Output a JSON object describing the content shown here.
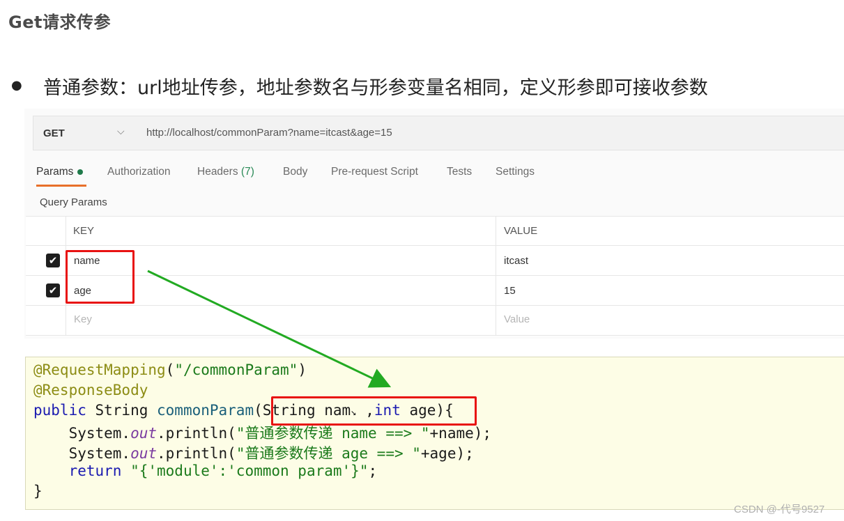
{
  "title": "Get请求传参",
  "bullet": {
    "symbol": "●",
    "text": "普通参数：url地址传参，地址参数名与形参变量名相同，定义形参即可接收参数"
  },
  "request": {
    "method": "GET",
    "url": "http://localhost/commonParam?name=itcast&age=15"
  },
  "tabs": [
    {
      "label": "Params"
    },
    {
      "label": "Authorization"
    },
    {
      "label": "Headers",
      "count": "(7)"
    },
    {
      "label": "Body"
    },
    {
      "label": "Pre-request Script"
    },
    {
      "label": "Tests"
    },
    {
      "label": "Settings"
    }
  ],
  "query_params_label": "Query Params",
  "table": {
    "headers": {
      "key": "KEY",
      "value": "VALUE"
    },
    "rows": [
      {
        "key": "name",
        "value": "itcast",
        "checked": true
      },
      {
        "key": "age",
        "value": "15",
        "checked": true
      }
    ],
    "placeholder": {
      "key": "Key",
      "value": "Value"
    }
  },
  "code": {
    "line1": {
      "ann": "@RequestMapping",
      "open": "(",
      "str": "\"/commonParam\"",
      "close": ")"
    },
    "line2": {
      "ann": "@ResponseBody"
    },
    "line3": {
      "kw": "public",
      "type": " String ",
      "fn": "commonParam",
      "params1": "(String nam",
      "cursor": "↘",
      "params2": " ,",
      "kw2": "int",
      "params3": " age)",
      "brace": "{"
    },
    "line4": {
      "indent": "    System.",
      "field": "out",
      "call": ".println(",
      "str": "\"普通参数传递 name ==> \"",
      "rest": "+name);"
    },
    "line5": {
      "indent": "    System.",
      "field": "out",
      "call": ".println(",
      "str": "\"普通参数传递 age ==> \"",
      "rest": "+age);"
    },
    "line6": {
      "indent": "    ",
      "kw": "return",
      "sp": " ",
      "str": "\"{'module':'common param'}\"",
      "rest": ";"
    },
    "line7": {
      "text": "}"
    }
  },
  "watermark": "CSDN @-代号9527",
  "colors": {
    "highlight_box": "#e81212",
    "arrow": "#22aa22",
    "active_tab_underline": "#e8702a"
  }
}
